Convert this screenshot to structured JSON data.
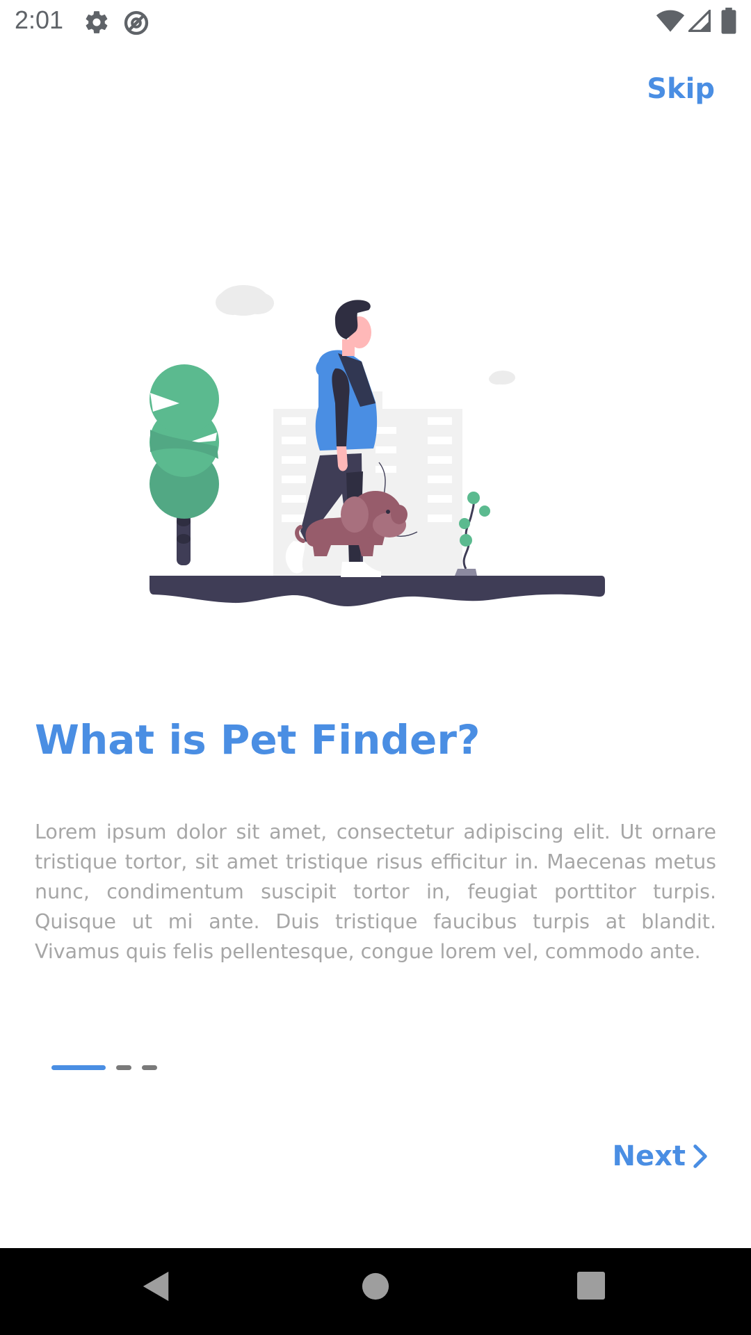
{
  "status_bar": {
    "time": "2:01",
    "left_icons": [
      "gear-icon",
      "no-sim-icon"
    ],
    "right_icons": [
      "wifi-icon",
      "signal-icon",
      "battery-icon"
    ]
  },
  "header": {
    "skip_label": "Skip"
  },
  "illustration": {
    "icon": "person-walking-dog-illustration"
  },
  "content": {
    "title": "What is Pet Finder?",
    "body": "Lorem ipsum dolor sit amet, consectetur adipiscing elit. Ut ornare tristique tortor, sit amet tristique risus efficitur in. Maecenas metus nunc, condimentum suscipit tortor in, feugiat porttitor turpis. Quisque ut mi ante. Duis tristique faucibus turpis at blandit. Vivamus quis felis pellentesque, congue lorem vel, commodo ante."
  },
  "pager": {
    "total": 3,
    "active_index": 0
  },
  "footer": {
    "next_label": "Next",
    "next_icon": "chevron-right-icon"
  },
  "navigation": {
    "buttons": [
      "back-icon",
      "home-icon",
      "recents-icon"
    ]
  },
  "colors": {
    "accent": "#4a8ee3",
    "body_text": "#a6a6a6",
    "indicator_inactive": "#7a7a7a"
  }
}
